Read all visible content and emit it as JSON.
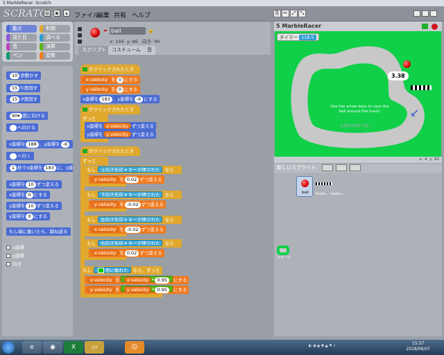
{
  "window": {
    "title": "5 MarbleRacer- Scratch"
  },
  "menu": {
    "logo": "SCRATCH",
    "items": [
      "ファイル",
      "編集",
      "共有",
      "ヘルプ"
    ]
  },
  "categories": [
    {
      "label": "動き",
      "color": "#4a6cd4"
    },
    {
      "label": "制御",
      "color": "#e0a92e"
    },
    {
      "label": "見た目",
      "color": "#8a55d7"
    },
    {
      "label": "調べる",
      "color": "#2d9ccf"
    },
    {
      "label": "音",
      "color": "#bb42c3"
    },
    {
      "label": "演算",
      "color": "#5cb712"
    },
    {
      "label": "ペン",
      "color": "#0e9a6c"
    },
    {
      "label": "変数",
      "color": "#ef7a20"
    }
  ],
  "palette": {
    "move": [
      "10",
      "歩動かす"
    ],
    "turn_cw": [
      "15",
      "度回す"
    ],
    "turn_ccw": [
      "15",
      "度回す"
    ],
    "point_dir": [
      "90▾",
      "度に向ける"
    ],
    "point_to": "へ向ける",
    "goto_xy": [
      "x座標を",
      "188",
      "、y座標を",
      "-6"
    ],
    "goto": "へ行く",
    "glide": [
      "1",
      "秒でx座標を",
      "183",
      "に、y座"
    ],
    "change_x": [
      "x座標を",
      "10",
      "ずつ変える"
    ],
    "set_x": [
      "x座標を",
      "0",
      "にする"
    ],
    "change_y": [
      "y座標を",
      "10",
      "ずつ変える"
    ],
    "set_y": [
      "y座標を",
      "0",
      "にする"
    ],
    "bounce": "もし端に着いたら、跳ね返る",
    "checks": [
      "x座標",
      "y座標",
      "向き"
    ]
  },
  "sprite": {
    "name": "ball",
    "x_label": "x:",
    "x": "144",
    "y_label": "y:",
    "y": "86",
    "dir_label": "向き:",
    "dir": "90"
  },
  "tabs": [
    "スクリプト",
    "コスチューム",
    "音"
  ],
  "scripts": {
    "hat_label": "がクリックされたとき",
    "s1": {
      "set1": [
        "x velocity",
        "を",
        "0",
        "にする"
      ],
      "set2": [
        "y velocity",
        "を",
        "0",
        "にする"
      ],
      "goto": [
        "x座標を",
        "183",
        "、y座標を",
        "-6",
        "にする"
      ]
    },
    "forever": "ずっと",
    "s2": {
      "cx": [
        "x座標を",
        "x velocity",
        "ずつ変える"
      ],
      "cy": [
        "y座標を",
        "y velocity",
        "ずつ変える"
      ]
    },
    "if_label": "もし",
    "key_pressed": "キーが押された",
    "nara": "なら",
    "keys": [
      {
        "key": "上向き矢印",
        "var": "y velocity",
        "val": "0.02"
      },
      {
        "key": "下向き矢印",
        "var": "y velocity",
        "val": "-0.02"
      },
      {
        "key": "左向き矢印",
        "var": "x velocity",
        "val": "-0.02"
      },
      {
        "key": "右向き矢印",
        "var": "x velocity",
        "val": "0.02"
      }
    ],
    "change_by": "ずつ変える",
    "color_touch": [
      "もし",
      "色に触れた",
      "なら、ずっと"
    ],
    "friction": [
      {
        "var": "x velocity",
        "op": "*",
        "val": "0.95"
      },
      {
        "var": "y velocity",
        "op": "*",
        "val": "0.95"
      }
    ],
    "to_label": "を",
    "set_label": "にする"
  },
  "stage": {
    "title": "5 MarbleRacer",
    "timer_label": "タイマー",
    "timer_value": "118.5",
    "lap_time": "3.38",
    "instructions": "Use the arrow keys to race the ball around the track!",
    "faint_text": "全角空白削除で開く",
    "coords": [
      "x: -4",
      "y: -62"
    ]
  },
  "sprites_panel": {
    "new_label": "新しいスプライト:",
    "items": [
      {
        "name": "ball"
      },
      {
        "name": "finish... instru..."
      },
      {
        "name": "ステージ"
      }
    ]
  },
  "taskbar": {
    "time": "15:57",
    "date": "2018/06/07"
  },
  "colors": {
    "stage_green": "#0fd048",
    "track_gray": "#c8c8c8"
  }
}
